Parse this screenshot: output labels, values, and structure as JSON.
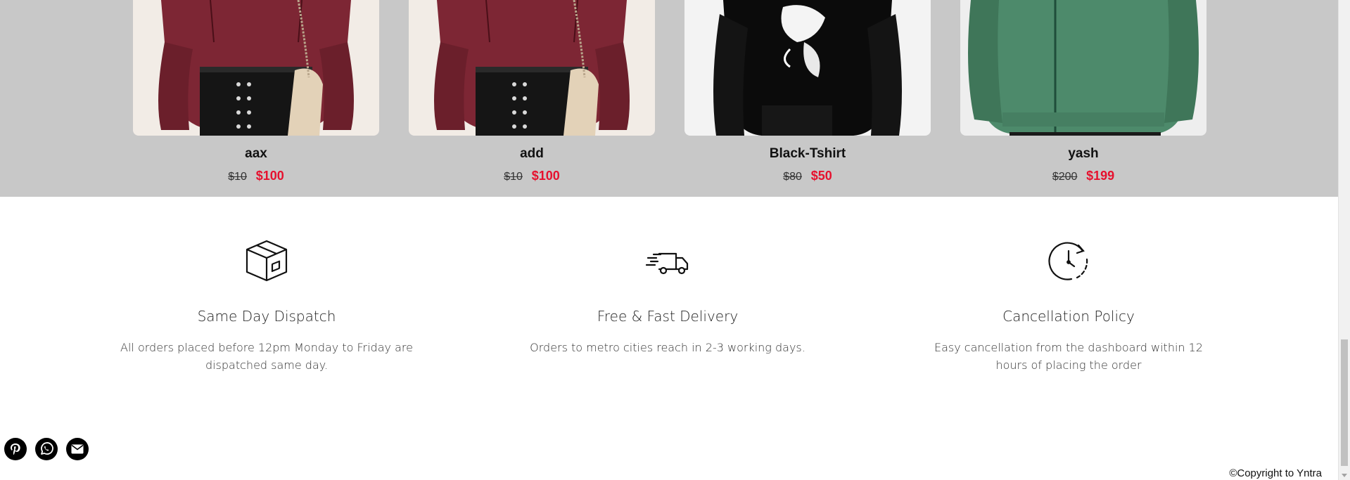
{
  "products": [
    {
      "name": "aax",
      "old_price": "$10",
      "new_price": "$100",
      "image": "maroon-hoodie-model"
    },
    {
      "name": "add",
      "old_price": "$10",
      "new_price": "$100",
      "image": "maroon-hoodie-model"
    },
    {
      "name": "Black-Tshirt",
      "old_price": "$80",
      "new_price": "$50",
      "image": "black-printed-sweatshirt"
    },
    {
      "name": "yash",
      "old_price": "$200",
      "new_price": "$199",
      "image": "green-zip-jacket"
    }
  ],
  "features": [
    {
      "icon": "box-icon",
      "title": "Same Day Dispatch",
      "desc": "All orders placed before 12pm Monday to Friday are dispatched same day."
    },
    {
      "icon": "delivery-truck-icon",
      "title": "Free & Fast Delivery",
      "desc": "Orders to metro cities reach in 2-3 working days."
    },
    {
      "icon": "clock-refresh-icon",
      "title": "Cancellation Policy",
      "desc": "Easy cancellation from the dashboard within 12 hours of placing the order"
    }
  ],
  "social": [
    "pinterest-icon",
    "whatsapp-icon",
    "email-icon"
  ],
  "footer": {
    "copyright": "©Copyright to Yntra"
  },
  "colors": {
    "product_bg": "#c8c8c8",
    "sale_price": "#e6112e",
    "icon_dark": "#000000"
  }
}
